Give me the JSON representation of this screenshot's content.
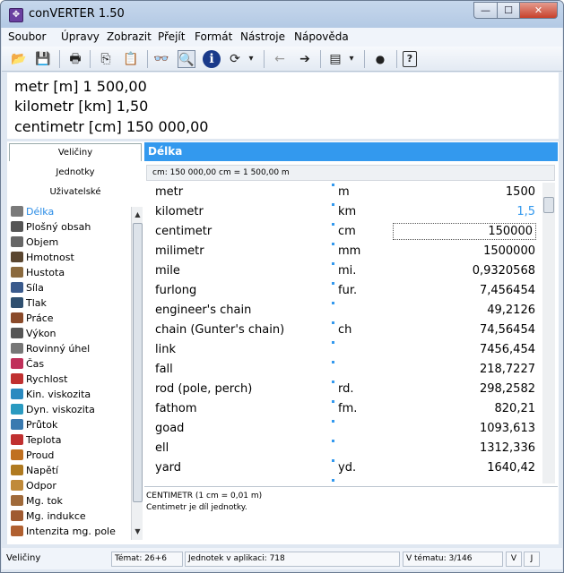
{
  "window": {
    "title": "conVERTER 1.50",
    "app_icon_glyph": "✥",
    "controls": {
      "minimize": "—",
      "maximize": "☐",
      "close": "✕"
    }
  },
  "menu": [
    "Soubor",
    "Úpravy",
    "Zobrazit",
    "Přejít",
    "Formát",
    "Nástroje",
    "Nápověda"
  ],
  "toolbar": {
    "icons": [
      "open-folder-icon",
      "save-icon",
      "print-icon",
      "copy-icon",
      "paste-icon",
      "glasses-icon",
      "find-icon",
      "info-icon",
      "refresh-icon",
      "dropdown-icon",
      "back-arrow-icon",
      "forward-arrow-icon",
      "list-icon",
      "dropdown-icon",
      "record-icon",
      "help-icon"
    ],
    "glyphs": {
      "open": "📂",
      "save": "💾",
      "print": "🖶",
      "copy": "⎘",
      "paste": "📋",
      "glasses": "👓",
      "find": "🔍",
      "info": "ℹ",
      "refresh": "⟳",
      "dd1": "▾",
      "back": "←",
      "forward": "➔",
      "list": "▤",
      "dd2": "▾",
      "record": "●",
      "help": "?"
    }
  },
  "results": [
    "metr [m] 1 500,00",
    "kilometr [km] 1,50",
    "centimetr [cm] 150 000,00"
  ],
  "left_panel": {
    "tabs": [
      "Veličiny",
      "Jednotky",
      "Uživatelské"
    ],
    "categories": [
      {
        "label": "Délka",
        "icon": "ruler-icon",
        "color": "#7a7a7a",
        "selected": true
      },
      {
        "label": "Plošný obsah",
        "icon": "area-icon",
        "color": "#555555"
      },
      {
        "label": "Objem",
        "icon": "volume-icon",
        "color": "#666666"
      },
      {
        "label": "Hmotnost",
        "icon": "weight-icon",
        "color": "#5a4630"
      },
      {
        "label": "Hustota",
        "icon": "density-icon",
        "color": "#8b6a3e"
      },
      {
        "label": "Síla",
        "icon": "dumbbell-icon",
        "color": "#3a5a8c"
      },
      {
        "label": "Tlak",
        "icon": "pressure-icon",
        "color": "#2f4f6f"
      },
      {
        "label": "Práce",
        "icon": "gear-icon",
        "color": "#8a4a2a"
      },
      {
        "label": "Výkon",
        "icon": "gauge-icon",
        "color": "#555555"
      },
      {
        "label": "Rovinný úhel",
        "icon": "protractor-icon",
        "color": "#777777"
      },
      {
        "label": "Čas",
        "icon": "clock-icon",
        "color": "#c0305a"
      },
      {
        "label": "Rychlost",
        "icon": "speedometer-icon",
        "color": "#c03030"
      },
      {
        "label": "Kin. viskozita",
        "icon": "drop-icon",
        "color": "#2a8ac0"
      },
      {
        "label": "Dyn. viskozita",
        "icon": "funnel-icon",
        "color": "#2a9ac0"
      },
      {
        "label": "Průtok",
        "icon": "flow-icon",
        "color": "#3a7ab0"
      },
      {
        "label": "Teplota",
        "icon": "thermometer-icon",
        "color": "#c03030"
      },
      {
        "label": "Proud",
        "icon": "current-icon",
        "color": "#c07020"
      },
      {
        "label": "Napětí",
        "icon": "battery-icon",
        "color": "#b07a20"
      },
      {
        "label": "Odpor",
        "icon": "resistor-icon",
        "color": "#c08a3a"
      },
      {
        "label": "Mg. tok",
        "icon": "magnetic-flux-icon",
        "color": "#a06a3a"
      },
      {
        "label": "Mg. indukce",
        "icon": "magnetic-induction-icon",
        "color": "#a05a30"
      },
      {
        "label": "Intenzita mg. pole",
        "icon": "compass-icon",
        "color": "#b06030"
      }
    ]
  },
  "right_panel": {
    "header": "Délka",
    "info_line": "cm: 150 000,00 cm = 1 500,00 m",
    "units": [
      {
        "name": "metr",
        "abbr": "m",
        "value": "1500"
      },
      {
        "name": "kilometr",
        "abbr": "km",
        "value": "1,5",
        "highlight": true
      },
      {
        "name": "centimetr",
        "abbr": "cm",
        "value": "150000",
        "editing": true
      },
      {
        "name": "milimetr",
        "abbr": "mm",
        "value": "1500000"
      },
      {
        "name": "mile",
        "abbr": "mi.",
        "value": "0,9320568"
      },
      {
        "name": "furlong",
        "abbr": "fur.",
        "value": "7,456454"
      },
      {
        "name": "engineer's chain",
        "abbr": "",
        "value": "49,2126"
      },
      {
        "name": "chain (Gunter's chain)",
        "abbr": "ch",
        "value": "74,56454"
      },
      {
        "name": "link",
        "abbr": "",
        "value": "7456,454"
      },
      {
        "name": "fall",
        "abbr": "",
        "value": "218,7227"
      },
      {
        "name": "rod (pole, perch)",
        "abbr": "rd.",
        "value": "298,2582"
      },
      {
        "name": "fathom",
        "abbr": "fm.",
        "value": "820,21"
      },
      {
        "name": "goad",
        "abbr": "",
        "value": "1093,613"
      },
      {
        "name": "ell",
        "abbr": "",
        "value": "1312,336"
      },
      {
        "name": "yard",
        "abbr": "yd.",
        "value": "1640,42"
      },
      {
        "name": "",
        "abbr": "",
        "value": ""
      }
    ],
    "description": {
      "title": "CENTIMETR (1 cm = 0,01 m)",
      "text": "Centimetr je díl jednotky."
    }
  },
  "status_bar": {
    "category": "Veličiny",
    "topics": "Témat: 26+6",
    "units_count": "Jednotek v aplikaci: 718",
    "in_topic": "V tématu: 3/146",
    "v": "V",
    "j": "J"
  },
  "colors": {
    "accent": "#3399ee",
    "window_frame": "#dfe7f1"
  }
}
